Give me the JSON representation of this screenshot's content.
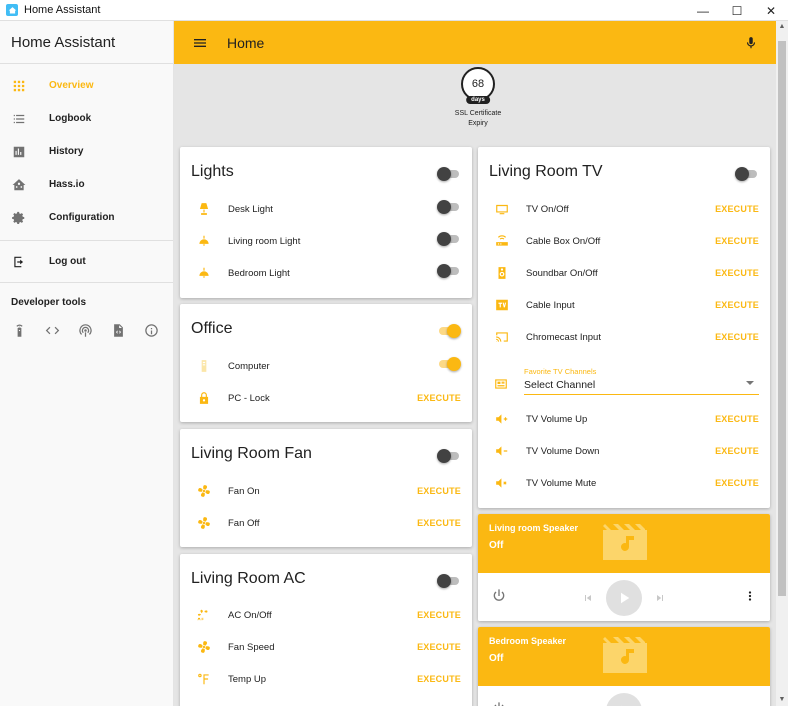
{
  "window": {
    "title": "Home Assistant",
    "minimize": "—",
    "maximize": "☐",
    "close": "✕"
  },
  "sidebar": {
    "title": "Home Assistant",
    "items": [
      {
        "label": "Overview",
        "icon": "grid-icon",
        "active": true
      },
      {
        "label": "Logbook",
        "icon": "list-icon"
      },
      {
        "label": "History",
        "icon": "chart-icon"
      },
      {
        "label": "Hass.io",
        "icon": "home-assistant-icon"
      },
      {
        "label": "Configuration",
        "icon": "gear-icon"
      }
    ],
    "logout": "Log out",
    "devtools_title": "Developer tools",
    "devtools_icons": [
      "remote-icon",
      "code-icon",
      "broadcast-icon",
      "file-code-icon",
      "info-icon"
    ]
  },
  "appbar": {
    "title": "Home"
  },
  "badge": {
    "value": "68",
    "unit": "days",
    "label": "SSL Certificate Expiry"
  },
  "cards": {
    "lights": {
      "title": "Lights",
      "rows": [
        {
          "label": "Desk Light",
          "icon": "desk-lamp-icon"
        },
        {
          "label": "Living room Light",
          "icon": "ceiling-light-icon"
        },
        {
          "label": "Bedroom Light",
          "icon": "ceiling-light-icon"
        }
      ]
    },
    "office": {
      "title": "Office",
      "rows": [
        {
          "label": "Computer",
          "icon": "desktop-tower-icon"
        },
        {
          "label": "PC - Lock",
          "icon": "lock-icon",
          "action": "EXECUTE"
        }
      ]
    },
    "fan": {
      "title": "Living Room Fan",
      "rows": [
        {
          "label": "Fan On",
          "icon": "fan-icon",
          "action": "EXECUTE"
        },
        {
          "label": "Fan Off",
          "icon": "fan-icon",
          "action": "EXECUTE"
        }
      ]
    },
    "ac": {
      "title": "Living Room AC",
      "rows": [
        {
          "label": "AC On/Off",
          "icon": "air-conditioner-icon",
          "action": "EXECUTE"
        },
        {
          "label": "Fan Speed",
          "icon": "fan-icon",
          "action": "EXECUTE"
        },
        {
          "label": "Temp Up",
          "icon": "temperature-fahrenheit-icon",
          "action": "EXECUTE"
        }
      ]
    },
    "tv": {
      "title": "Living Room TV",
      "rows": [
        {
          "label": "TV On/Off",
          "icon": "television-icon",
          "action": "EXECUTE"
        },
        {
          "label": "Cable Box On/Off",
          "icon": "router-icon",
          "action": "EXECUTE"
        },
        {
          "label": "Soundbar On/Off",
          "icon": "speaker-icon",
          "action": "EXECUTE"
        },
        {
          "label": "Cable Input",
          "icon": "tv-box-icon",
          "action": "EXECUTE"
        },
        {
          "label": "Chromecast Input",
          "icon": "cast-icon",
          "action": "EXECUTE"
        }
      ],
      "select": {
        "label": "Favorite TV Channels",
        "value": "Select Channel",
        "icon": "tv-guide-icon"
      },
      "rows2": [
        {
          "label": "TV Volume Up",
          "icon": "volume-plus-icon",
          "action": "EXECUTE"
        },
        {
          "label": "TV Volume Down",
          "icon": "volume-minus-icon",
          "action": "EXECUTE"
        },
        {
          "label": "TV Volume Mute",
          "icon": "volume-mute-icon",
          "action": "EXECUTE"
        }
      ]
    }
  },
  "media": [
    {
      "name": "Living room Speaker",
      "state": "Off"
    },
    {
      "name": "Bedroom Speaker",
      "state": "Off"
    }
  ],
  "colors": {
    "accent": "#fbb812",
    "sidebar_bg": "#f9f9f9",
    "main_bg": "#e5e5e5"
  }
}
